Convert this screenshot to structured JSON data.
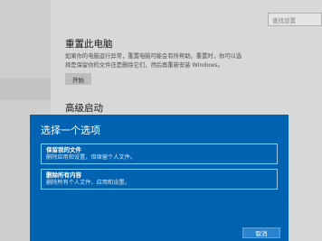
{
  "settings": {
    "search_placeholder": "查找设置",
    "reset_title": "重置此电脑",
    "reset_description": "如果你的电脑运行异常，重置电脑可能会有所帮助。重置时，你可以选择是保留你的文件还是删除它们，然后再重新安装 Windows。",
    "start_button": "开始",
    "advanced_title": "高级启动"
  },
  "dialog": {
    "title": "选择一个选项",
    "options": [
      {
        "title": "保留我的文件",
        "description": "删除应用和设置，但保留个人文件。"
      },
      {
        "title": "删除所有内容",
        "description": "删除所有个人文件、应用和设置。"
      }
    ],
    "cancel_button": "取消"
  },
  "colors": {
    "dialog_background": "#0063b1",
    "page_background": "#e6e6e6"
  }
}
